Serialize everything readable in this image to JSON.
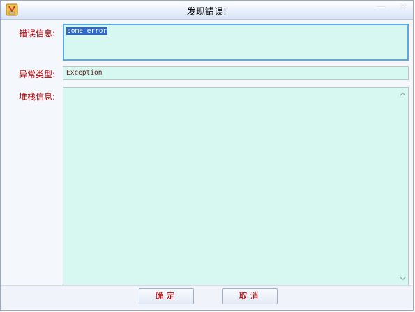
{
  "window": {
    "title": "发现错误!",
    "minimize_glyph": "—",
    "close_glyph": "✕"
  },
  "fields": {
    "error_message": {
      "label": "错误信息:",
      "value": "some error"
    },
    "exception_type": {
      "label": "异常类型:",
      "value": "Exception"
    },
    "stack_trace": {
      "label": "堆栈信息:",
      "value": ""
    }
  },
  "buttons": {
    "ok_label": "确定",
    "cancel_label": "取消"
  },
  "colors": {
    "label": "#c00000",
    "field_background": "#d6f8f1",
    "focus_border": "#5aa8e8",
    "selection": "#3169c6"
  },
  "icons": [
    "app-icon",
    "minimize-icon",
    "close-icon",
    "scroll-up-icon",
    "scroll-down-icon"
  ]
}
